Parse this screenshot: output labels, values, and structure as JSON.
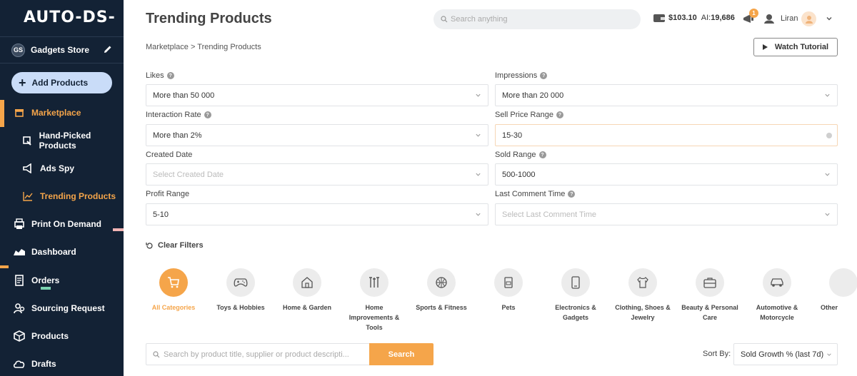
{
  "app": {
    "logo": "AUTO-DS-"
  },
  "sidebar": {
    "store_initials": "GS",
    "store_name": "Gadgets Store",
    "add_products": "Add Products",
    "items": [
      {
        "label": "Marketplace",
        "icon": "store-icon"
      },
      {
        "label": "Hand-Picked Products",
        "icon": "hand-picked-icon"
      },
      {
        "label": "Ads Spy",
        "icon": "megaphone-icon"
      },
      {
        "label": "Trending Products",
        "icon": "chart-line-icon"
      },
      {
        "label": "Print On Demand",
        "icon": "print-icon"
      },
      {
        "label": "Dashboard",
        "icon": "dashboard-icon"
      },
      {
        "label": "Orders",
        "icon": "orders-icon"
      },
      {
        "label": "Sourcing Request",
        "icon": "sourcing-icon"
      },
      {
        "label": "Products",
        "icon": "box-icon"
      },
      {
        "label": "Drafts",
        "icon": "cloud-icon"
      }
    ],
    "accent_color": "#f5a54a",
    "background_color": "#132235"
  },
  "header": {
    "title": "Trending Products",
    "search_placeholder": "Search anything",
    "balance": "$103.10",
    "ai_label": "AI:",
    "ai_value": "19,686",
    "notification_count": "1",
    "user_name": "Liran"
  },
  "breadcrumb": "Marketplace > Trending Products",
  "watch_tutorial": "Watch Tutorial",
  "filters": {
    "likes": {
      "label": "Likes",
      "value": "More than 50 000"
    },
    "impressions": {
      "label": "Impressions",
      "value": "More than 20 000"
    },
    "interaction_rate": {
      "label": "Interaction Rate",
      "value": "More than 2%"
    },
    "sell_price_range": {
      "label": "Sell Price Range",
      "value": "15-30"
    },
    "created_date": {
      "label": "Created Date",
      "placeholder": "Select Created Date"
    },
    "sold_range": {
      "label": "Sold Range",
      "value": "500-1000"
    },
    "profit_range": {
      "label": "Profit Range",
      "value": "5-10"
    },
    "last_comment_time": {
      "label": "Last Comment Time",
      "placeholder": "Select Last Comment Time"
    },
    "clear_label": "Clear Filters"
  },
  "categories": [
    {
      "label": "All Categories",
      "icon": "cart-icon",
      "active": true
    },
    {
      "label": "Toys & Hobbies",
      "icon": "gamepad-icon"
    },
    {
      "label": "Home & Garden",
      "icon": "house-icon"
    },
    {
      "label": "Home Improvements & Tools",
      "icon": "tools-icon"
    },
    {
      "label": "Sports & Fitness",
      "icon": "basketball-icon"
    },
    {
      "label": "Pets",
      "icon": "pet-food-icon"
    },
    {
      "label": "Electronics & Gadgets",
      "icon": "phone-icon"
    },
    {
      "label": "Clothing, Shoes & Jewelry",
      "icon": "shirt-icon"
    },
    {
      "label": "Beauty & Personal Care",
      "icon": "beauty-case-icon"
    },
    {
      "label": "Automotive & Motorcycle",
      "icon": "car-icon"
    },
    {
      "label": "Other",
      "icon": "other-icon"
    }
  ],
  "product_search": {
    "placeholder": "Search by product title, supplier or product descripti...",
    "button": "Search",
    "sort_label": "Sort By:",
    "sort_value": "Sold Growth % (last 7d)"
  }
}
